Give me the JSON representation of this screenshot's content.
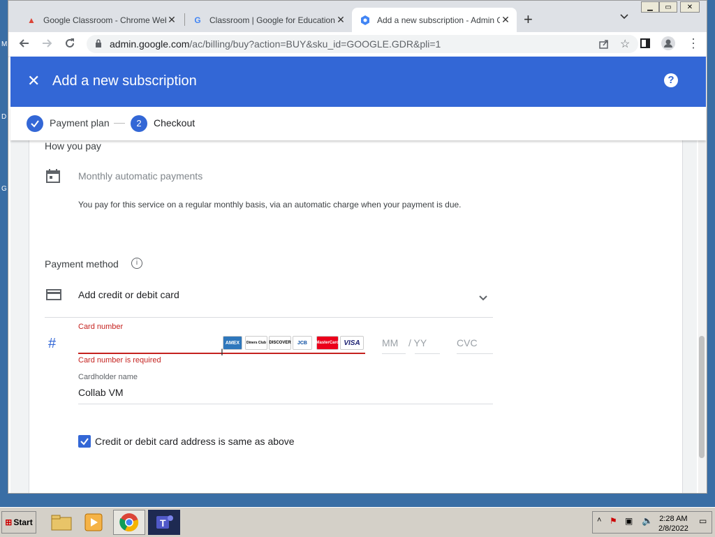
{
  "desktop": {
    "labels": [
      "M",
      "D",
      "G"
    ]
  },
  "browser": {
    "tabs": [
      {
        "title": "Google Classroom - Chrome Web St"
      },
      {
        "title": "Classroom | Google for Education"
      },
      {
        "title": "Add a new subscription - Admin Co"
      }
    ],
    "url": {
      "host": "admin.google.com",
      "path": "/ac/billing/buy?action=BUY&sku_id=GOOGLE.GDR&pli=1"
    }
  },
  "app": {
    "title": "Add a new subscription",
    "help": "?",
    "close": "✕"
  },
  "stepper": {
    "step1": "Payment plan",
    "step2_number": "2",
    "step2": "Checkout"
  },
  "how_you_pay": {
    "heading": "How you pay",
    "option": "Monthly automatic payments",
    "description": "You pay for this service on a regular monthly basis, via an automatic charge when your payment is due."
  },
  "payment_method": {
    "heading": "Payment method",
    "info": "i",
    "selector_label": "Add credit or debit card",
    "card_number_label": "Card number",
    "card_number_error": "Card number is required",
    "card_logos": [
      "AMEX",
      "Diners Club",
      "DISCOVER",
      "JCB",
      "MasterCard",
      "VISA"
    ],
    "mm_placeholder": "MM",
    "yy_placeholder": "/ YY",
    "cvc_placeholder": "CVC",
    "cardholder_label": "Cardholder name",
    "cardholder_value": "Collab VM",
    "address_same_label": "Credit or debit card address is same as above",
    "address_same_checked": true
  },
  "colors": {
    "accent": "#3367d6",
    "error": "#c5221f"
  },
  "taskbar": {
    "start": "Start",
    "time": "2:28 AM",
    "date": "2/8/2022"
  }
}
